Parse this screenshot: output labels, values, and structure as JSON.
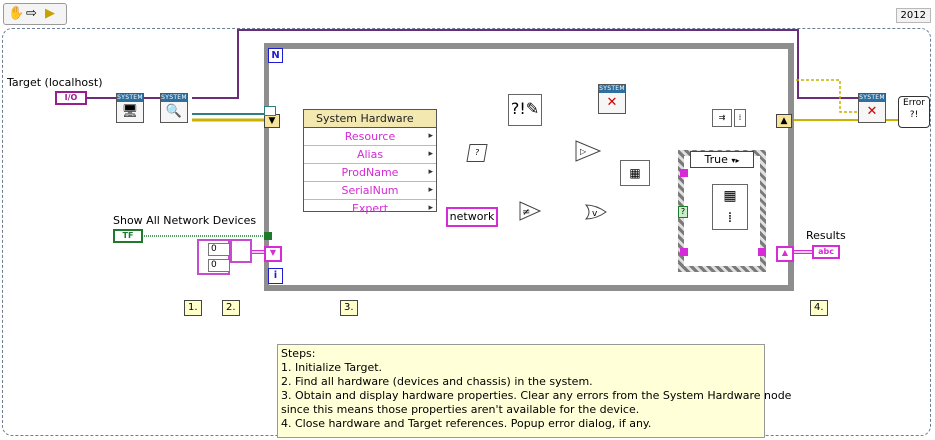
{
  "toolbar": {
    "hand_icon": "hand-icon",
    "arrow_icon": "arrow-icon",
    "run_icon": "run-icon"
  },
  "version_label": "2012",
  "controls": {
    "target_label": "Target (localhost)",
    "target_constant": "I/O",
    "show_all_label": "Show All Network Devices",
    "show_all_constant": "TF",
    "array_values": [
      "0",
      "0"
    ],
    "results_label": "Results",
    "results_indicator": "abc"
  },
  "system_vis": {
    "header": "SYSTEM"
  },
  "loop": {
    "n_label": "N",
    "i_label": "i"
  },
  "property_node": {
    "title": "System Hardware",
    "properties": [
      "Resource",
      "Alias",
      "ProdName",
      "SerialNum",
      "Expert"
    ]
  },
  "string_constant": "network",
  "case_structure": {
    "selector": "True"
  },
  "steps_labels": [
    "1.",
    "2.",
    "3.",
    "4."
  ],
  "error_button": "Error",
  "notes": {
    "heading": "Steps:",
    "lines": [
      "1. Initialize Target.",
      "2. Find all hardware (devices and chassis) in the system.",
      "3. Obtain and display hardware properties. Clear any errors from the System Hardware node",
      "since this means those properties aren't available for the device.",
      "4. Close hardware and Target references. Popup error dialog, if any."
    ]
  },
  "colors": {
    "refnum_wire": "#6b2c7a",
    "string_wire": "#d62bd6",
    "error_wire": "#c9b200",
    "boolean_wire": "#1f7a2e",
    "structure_gray": "#8e8e8e"
  }
}
